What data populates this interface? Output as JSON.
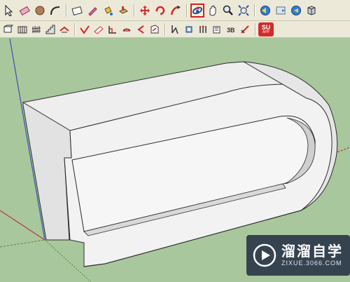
{
  "toolbar_main": {
    "tools": [
      "select-tool",
      "eraser-tool",
      "circle-tool",
      "arc-tool",
      "rectangle-tool",
      "pencil-tool",
      "paint-bucket-tool",
      "push-pull-tool",
      "move-tool",
      "rotate-tool",
      "follow-me-tool",
      "orbit-tool",
      "pan-tool",
      "zoom-tool",
      "zoom-extents-tool",
      "previous-view-tool",
      "next-view-tool",
      "3d-warehouse-tool",
      "components-tool"
    ],
    "active_tool": "orbit-tool"
  },
  "toolbar_secondary": {
    "tools": [
      "section-plane-tool",
      "walls-tool",
      "fence-tool",
      "stairs-tool",
      "roof-tool",
      "measure-tool",
      "dimension-tool",
      "protractor-tool",
      "text-tool",
      "axes-tool",
      "3d-text-tool",
      "position-camera-tool",
      "walk-tool",
      "look-around-tool",
      "shadow-tool",
      "fog-tool"
    ],
    "su_app_badge": {
      "top": "SU",
      "bottom": "APP"
    }
  },
  "viewport": {
    "background_color": "#a9c79c",
    "model": "3D-U-shaped-extrusion"
  },
  "watermark": {
    "title": "溜溜自学",
    "url": "ZIXUE.3066.COM"
  }
}
